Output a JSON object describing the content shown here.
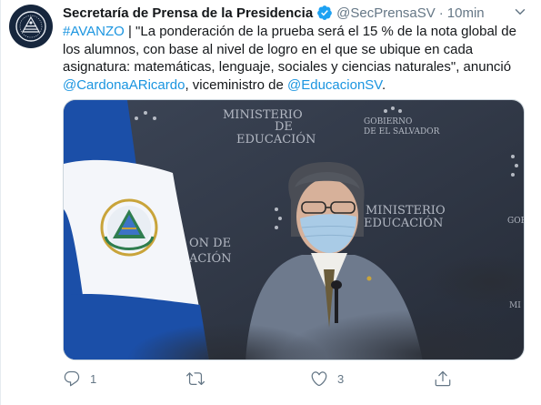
{
  "tweet": {
    "display_name": "Secretaría de Prensa de la Presidencia",
    "handle": "@SecPrensaSV",
    "separator": "·",
    "time": "10min",
    "text": {
      "hashtag": "#AVANZO",
      "body_1": " | \"La ponderación de la prueba será el 15 % de la nota global de los alumnos, con base al nivel de logro en el que se ubique en cada asignatura: matemáticas, lenguaje, sociales y ciencias naturales\", anunció ",
      "mention_1": "@CardonaARicardo",
      "body_2": ", viceministro de ",
      "mention_2": "@EducacionSV",
      "body_3": "."
    },
    "image": {
      "backdrop_text": [
        "MINISTERIO",
        "DE",
        "EDUCACIÓN",
        "GOBIERNO",
        "DE EL SALVADOR",
        "MINISTERIO",
        "DE",
        "EDUCACIÓN",
        "GOB",
        "ON DE",
        "ACIÓN",
        "MI"
      ],
      "flag_colors": {
        "blue": "#1b4fa8",
        "white": "#f4f6fa"
      }
    },
    "actions": {
      "reply_count": "1",
      "retweet_count": "",
      "like_count": "3"
    },
    "icons": {
      "avatar": "el-salvador-seal-icon",
      "verified": "verified-badge-icon",
      "more": "chevron-down-icon",
      "reply": "reply-icon",
      "retweet": "retweet-icon",
      "like": "heart-icon",
      "share": "share-icon"
    },
    "colors": {
      "link": "#1b95e0",
      "secondary": "#657786",
      "verified": "#1da1f2",
      "avatar_bg": "#16263d"
    }
  }
}
